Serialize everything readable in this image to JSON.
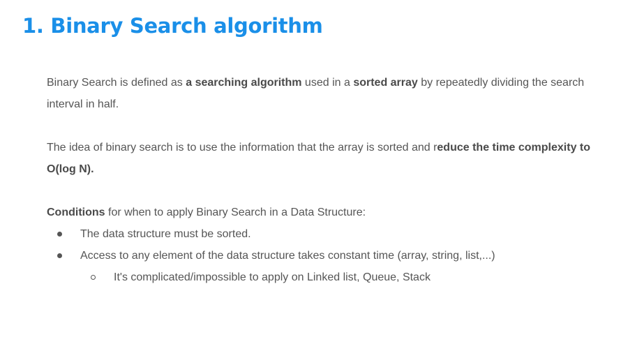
{
  "title": "1. Binary Search algorithm",
  "paragraph1": {
    "t1": "Binary Search is defined as ",
    "b1": "a searching algorithm",
    "t2": " used in a ",
    "b2": "sorted array",
    "t3": " by repeatedly dividing the search interval in half."
  },
  "paragraph2": {
    "t1": "The idea of binary search is to use the information that the array is sorted and r",
    "b1": "educe the time complexity to O(log N)."
  },
  "conditions": {
    "label": "Conditions",
    "text": " for when to apply Binary Search in a Data Structure:",
    "bullets": [
      "The data structure must be sorted.",
      "Access to any element of the data structure takes constant time (array, string, list,...)"
    ],
    "sub_bullets": [
      "It's complicated/impossible to apply on Linked list, Queue, Stack"
    ]
  }
}
